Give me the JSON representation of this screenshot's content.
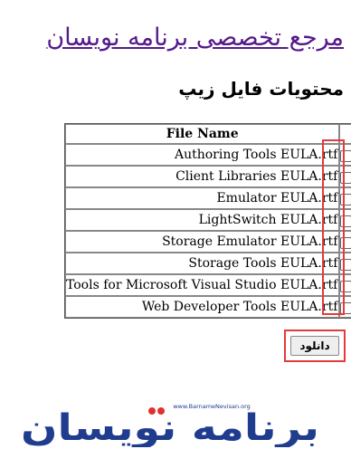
{
  "page": {
    "title": "مرجع تخصصی برنامه نویسان"
  },
  "section": {
    "title": "محتویات فایل زیپ"
  },
  "table": {
    "header": "File Name",
    "rows": [
      {
        "name": "Authoring Tools EULA.rtf",
        "checked": false
      },
      {
        "name": "Client Libraries EULA.rtf",
        "checked": false
      },
      {
        "name": "Emulator EULA.rtf",
        "checked": false
      },
      {
        "name": "LightSwitch EULA.rtf",
        "checked": false
      },
      {
        "name": "Storage Emulator EULA.rtf",
        "checked": false
      },
      {
        "name": "Storage Tools EULA.rtf",
        "checked": false
      },
      {
        "name": "Tools for Microsoft Visual Studio EULA.rtf",
        "checked": false
      },
      {
        "name": "Web Developer Tools EULA.rtf",
        "checked": false
      }
    ]
  },
  "download_button": {
    "label": "دانلود"
  },
  "logo": {
    "text": "برنامه نویسان",
    "url_text": "www.BarnameNevisan.org"
  },
  "colors": {
    "link": "#551a8b",
    "highlight": "#e23c3c",
    "logo_blue": "#1f3c8f",
    "logo_red": "#e0312f"
  }
}
